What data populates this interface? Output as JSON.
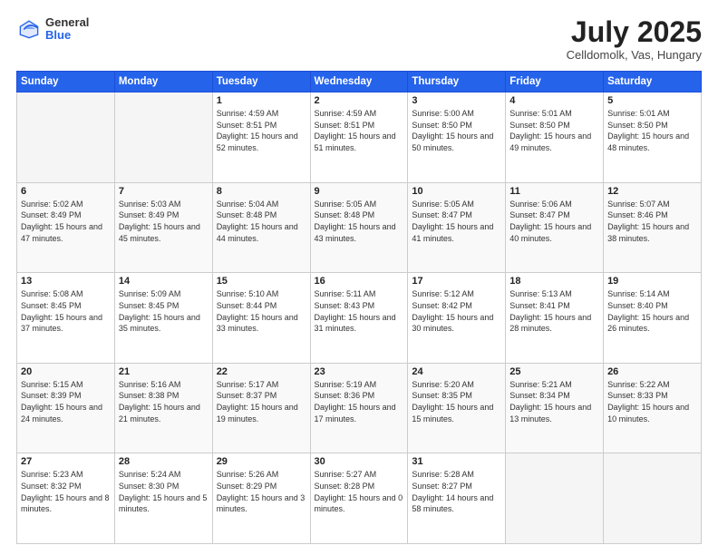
{
  "header": {
    "logo_general": "General",
    "logo_blue": "Blue",
    "month_title": "July 2025",
    "subtitle": "Celldomolk, Vas, Hungary"
  },
  "calendar": {
    "days_of_week": [
      "Sunday",
      "Monday",
      "Tuesday",
      "Wednesday",
      "Thursday",
      "Friday",
      "Saturday"
    ],
    "weeks": [
      [
        {
          "day": "",
          "sunrise": "",
          "sunset": "",
          "daylight": ""
        },
        {
          "day": "",
          "sunrise": "",
          "sunset": "",
          "daylight": ""
        },
        {
          "day": "1",
          "sunrise": "Sunrise: 4:59 AM",
          "sunset": "Sunset: 8:51 PM",
          "daylight": "Daylight: 15 hours and 52 minutes."
        },
        {
          "day": "2",
          "sunrise": "Sunrise: 4:59 AM",
          "sunset": "Sunset: 8:51 PM",
          "daylight": "Daylight: 15 hours and 51 minutes."
        },
        {
          "day": "3",
          "sunrise": "Sunrise: 5:00 AM",
          "sunset": "Sunset: 8:50 PM",
          "daylight": "Daylight: 15 hours and 50 minutes."
        },
        {
          "day": "4",
          "sunrise": "Sunrise: 5:01 AM",
          "sunset": "Sunset: 8:50 PM",
          "daylight": "Daylight: 15 hours and 49 minutes."
        },
        {
          "day": "5",
          "sunrise": "Sunrise: 5:01 AM",
          "sunset": "Sunset: 8:50 PM",
          "daylight": "Daylight: 15 hours and 48 minutes."
        }
      ],
      [
        {
          "day": "6",
          "sunrise": "Sunrise: 5:02 AM",
          "sunset": "Sunset: 8:49 PM",
          "daylight": "Daylight: 15 hours and 47 minutes."
        },
        {
          "day": "7",
          "sunrise": "Sunrise: 5:03 AM",
          "sunset": "Sunset: 8:49 PM",
          "daylight": "Daylight: 15 hours and 45 minutes."
        },
        {
          "day": "8",
          "sunrise": "Sunrise: 5:04 AM",
          "sunset": "Sunset: 8:48 PM",
          "daylight": "Daylight: 15 hours and 44 minutes."
        },
        {
          "day": "9",
          "sunrise": "Sunrise: 5:05 AM",
          "sunset": "Sunset: 8:48 PM",
          "daylight": "Daylight: 15 hours and 43 minutes."
        },
        {
          "day": "10",
          "sunrise": "Sunrise: 5:05 AM",
          "sunset": "Sunset: 8:47 PM",
          "daylight": "Daylight: 15 hours and 41 minutes."
        },
        {
          "day": "11",
          "sunrise": "Sunrise: 5:06 AM",
          "sunset": "Sunset: 8:47 PM",
          "daylight": "Daylight: 15 hours and 40 minutes."
        },
        {
          "day": "12",
          "sunrise": "Sunrise: 5:07 AM",
          "sunset": "Sunset: 8:46 PM",
          "daylight": "Daylight: 15 hours and 38 minutes."
        }
      ],
      [
        {
          "day": "13",
          "sunrise": "Sunrise: 5:08 AM",
          "sunset": "Sunset: 8:45 PM",
          "daylight": "Daylight: 15 hours and 37 minutes."
        },
        {
          "day": "14",
          "sunrise": "Sunrise: 5:09 AM",
          "sunset": "Sunset: 8:45 PM",
          "daylight": "Daylight: 15 hours and 35 minutes."
        },
        {
          "day": "15",
          "sunrise": "Sunrise: 5:10 AM",
          "sunset": "Sunset: 8:44 PM",
          "daylight": "Daylight: 15 hours and 33 minutes."
        },
        {
          "day": "16",
          "sunrise": "Sunrise: 5:11 AM",
          "sunset": "Sunset: 8:43 PM",
          "daylight": "Daylight: 15 hours and 31 minutes."
        },
        {
          "day": "17",
          "sunrise": "Sunrise: 5:12 AM",
          "sunset": "Sunset: 8:42 PM",
          "daylight": "Daylight: 15 hours and 30 minutes."
        },
        {
          "day": "18",
          "sunrise": "Sunrise: 5:13 AM",
          "sunset": "Sunset: 8:41 PM",
          "daylight": "Daylight: 15 hours and 28 minutes."
        },
        {
          "day": "19",
          "sunrise": "Sunrise: 5:14 AM",
          "sunset": "Sunset: 8:40 PM",
          "daylight": "Daylight: 15 hours and 26 minutes."
        }
      ],
      [
        {
          "day": "20",
          "sunrise": "Sunrise: 5:15 AM",
          "sunset": "Sunset: 8:39 PM",
          "daylight": "Daylight: 15 hours and 24 minutes."
        },
        {
          "day": "21",
          "sunrise": "Sunrise: 5:16 AM",
          "sunset": "Sunset: 8:38 PM",
          "daylight": "Daylight: 15 hours and 21 minutes."
        },
        {
          "day": "22",
          "sunrise": "Sunrise: 5:17 AM",
          "sunset": "Sunset: 8:37 PM",
          "daylight": "Daylight: 15 hours and 19 minutes."
        },
        {
          "day": "23",
          "sunrise": "Sunrise: 5:19 AM",
          "sunset": "Sunset: 8:36 PM",
          "daylight": "Daylight: 15 hours and 17 minutes."
        },
        {
          "day": "24",
          "sunrise": "Sunrise: 5:20 AM",
          "sunset": "Sunset: 8:35 PM",
          "daylight": "Daylight: 15 hours and 15 minutes."
        },
        {
          "day": "25",
          "sunrise": "Sunrise: 5:21 AM",
          "sunset": "Sunset: 8:34 PM",
          "daylight": "Daylight: 15 hours and 13 minutes."
        },
        {
          "day": "26",
          "sunrise": "Sunrise: 5:22 AM",
          "sunset": "Sunset: 8:33 PM",
          "daylight": "Daylight: 15 hours and 10 minutes."
        }
      ],
      [
        {
          "day": "27",
          "sunrise": "Sunrise: 5:23 AM",
          "sunset": "Sunset: 8:32 PM",
          "daylight": "Daylight: 15 hours and 8 minutes."
        },
        {
          "day": "28",
          "sunrise": "Sunrise: 5:24 AM",
          "sunset": "Sunset: 8:30 PM",
          "daylight": "Daylight: 15 hours and 5 minutes."
        },
        {
          "day": "29",
          "sunrise": "Sunrise: 5:26 AM",
          "sunset": "Sunset: 8:29 PM",
          "daylight": "Daylight: 15 hours and 3 minutes."
        },
        {
          "day": "30",
          "sunrise": "Sunrise: 5:27 AM",
          "sunset": "Sunset: 8:28 PM",
          "daylight": "Daylight: 15 hours and 0 minutes."
        },
        {
          "day": "31",
          "sunrise": "Sunrise: 5:28 AM",
          "sunset": "Sunset: 8:27 PM",
          "daylight": "Daylight: 14 hours and 58 minutes."
        },
        {
          "day": "",
          "sunrise": "",
          "sunset": "",
          "daylight": ""
        },
        {
          "day": "",
          "sunrise": "",
          "sunset": "",
          "daylight": ""
        }
      ]
    ]
  }
}
